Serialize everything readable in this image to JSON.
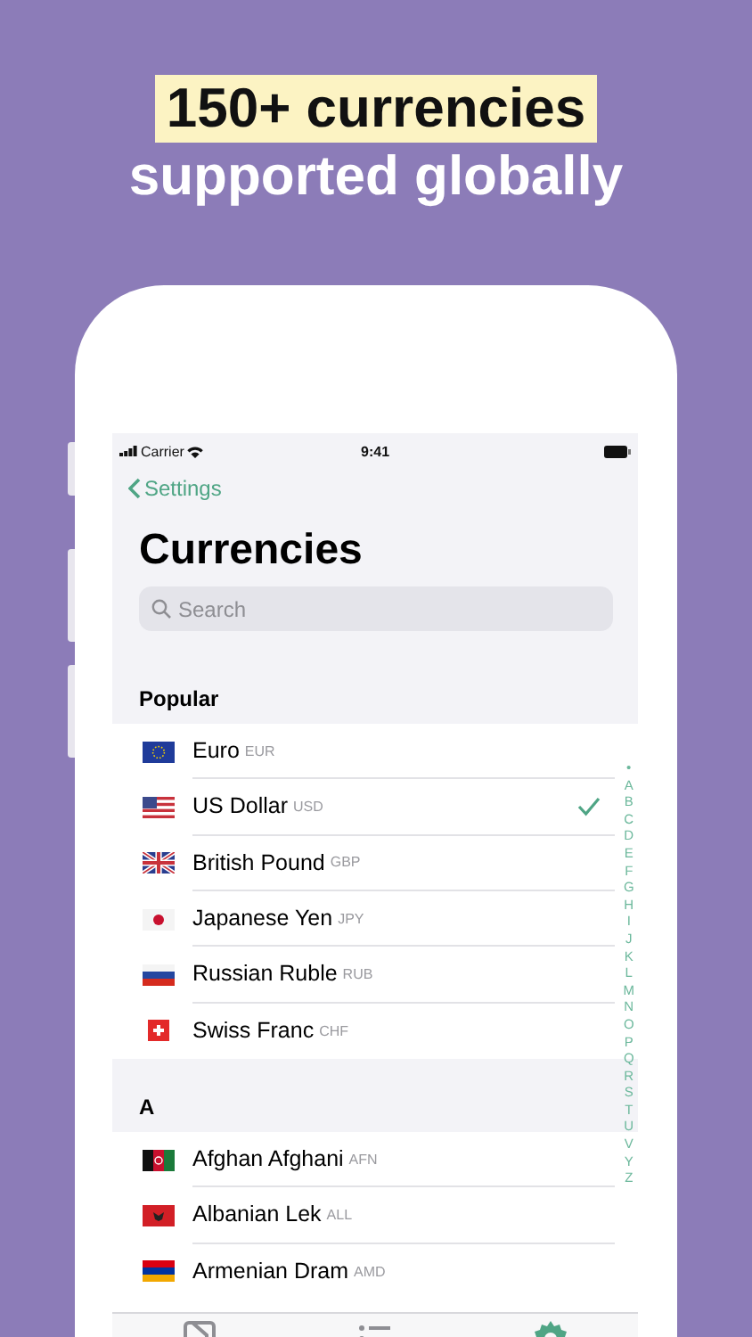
{
  "headline": {
    "highlighted": "150+ currencies",
    "subtitle": "supported globally"
  },
  "status_bar": {
    "carrier": "Carrier",
    "time": "9:41"
  },
  "nav": {
    "back": "Settings",
    "title": "Currencies"
  },
  "search": {
    "placeholder": "Search"
  },
  "sections": [
    {
      "title": "Popular",
      "rows": [
        {
          "kind": "eu",
          "name": "Euro",
          "code": "EUR",
          "selected": false
        },
        {
          "kind": "us",
          "name": "US Dollar",
          "code": "USD",
          "selected": true
        },
        {
          "kind": "gb",
          "name": "British Pound",
          "code": "GBP",
          "selected": false
        },
        {
          "kind": "jp",
          "name": "Japanese Yen",
          "code": "JPY",
          "selected": false
        },
        {
          "kind": "ru",
          "name": "Russian Ruble",
          "code": "RUB",
          "selected": false
        },
        {
          "kind": "ch",
          "name": "Swiss Franc",
          "code": "CHF",
          "selected": false
        }
      ]
    },
    {
      "title": "A",
      "rows": [
        {
          "kind": "af",
          "name": "Afghan Afghani",
          "code": "AFN",
          "selected": false
        },
        {
          "kind": "al",
          "name": "Albanian Lek",
          "code": "ALL",
          "selected": false
        },
        {
          "kind": "am",
          "name": "Armenian Dram",
          "code": "AMD",
          "selected": false
        }
      ]
    }
  ],
  "index": [
    "•",
    "A",
    "B",
    "C",
    "D",
    "E",
    "F",
    "G",
    "H",
    "I",
    "J",
    "K",
    "L",
    "M",
    "N",
    "O",
    "P",
    "Q",
    "R",
    "S",
    "T",
    "U",
    "V",
    "Y",
    "Z"
  ],
  "tabs": [
    {
      "kind": "book",
      "selected": false
    },
    {
      "kind": "list",
      "selected": false
    },
    {
      "kind": "gear",
      "selected": true
    }
  ]
}
